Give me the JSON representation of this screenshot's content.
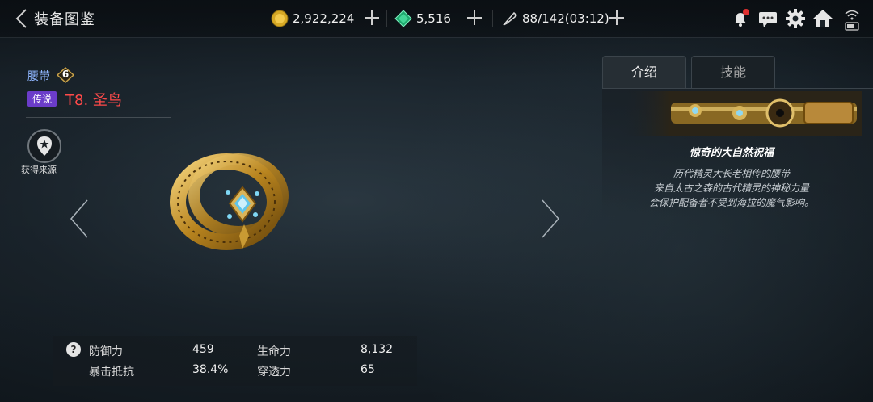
{
  "header": {
    "title": "装备图鉴",
    "gold": "2,922,224",
    "gems": "5,516",
    "stamina": "88/142(03:12)"
  },
  "item": {
    "slot": "腰带",
    "level": "6",
    "rarity": "传说",
    "name": "T8. 圣鸟",
    "source_label": "获得来源"
  },
  "stats": {
    "defense_label": "防御力",
    "defense_value": "459",
    "hp_label": "生命力",
    "hp_value": "8,132",
    "crit_resist_label": "暴击抵抗",
    "crit_resist_value": "38.4%",
    "penetration_label": "穿透力",
    "penetration_value": "65"
  },
  "tabs": {
    "intro": "介绍",
    "skill": "技能"
  },
  "description": {
    "title": "惊奇的大自然祝福",
    "line1": "历代精灵大长老相传的腰带",
    "line2": "来自太古之森的古代精灵的神秘力量",
    "line3": "会保护配备者不受到海拉的魔气影响。"
  },
  "colors": {
    "rarity_purple": "#6b3cc9",
    "item_name_red": "#ff4a4a",
    "slot_blue": "#8fb6ff"
  }
}
